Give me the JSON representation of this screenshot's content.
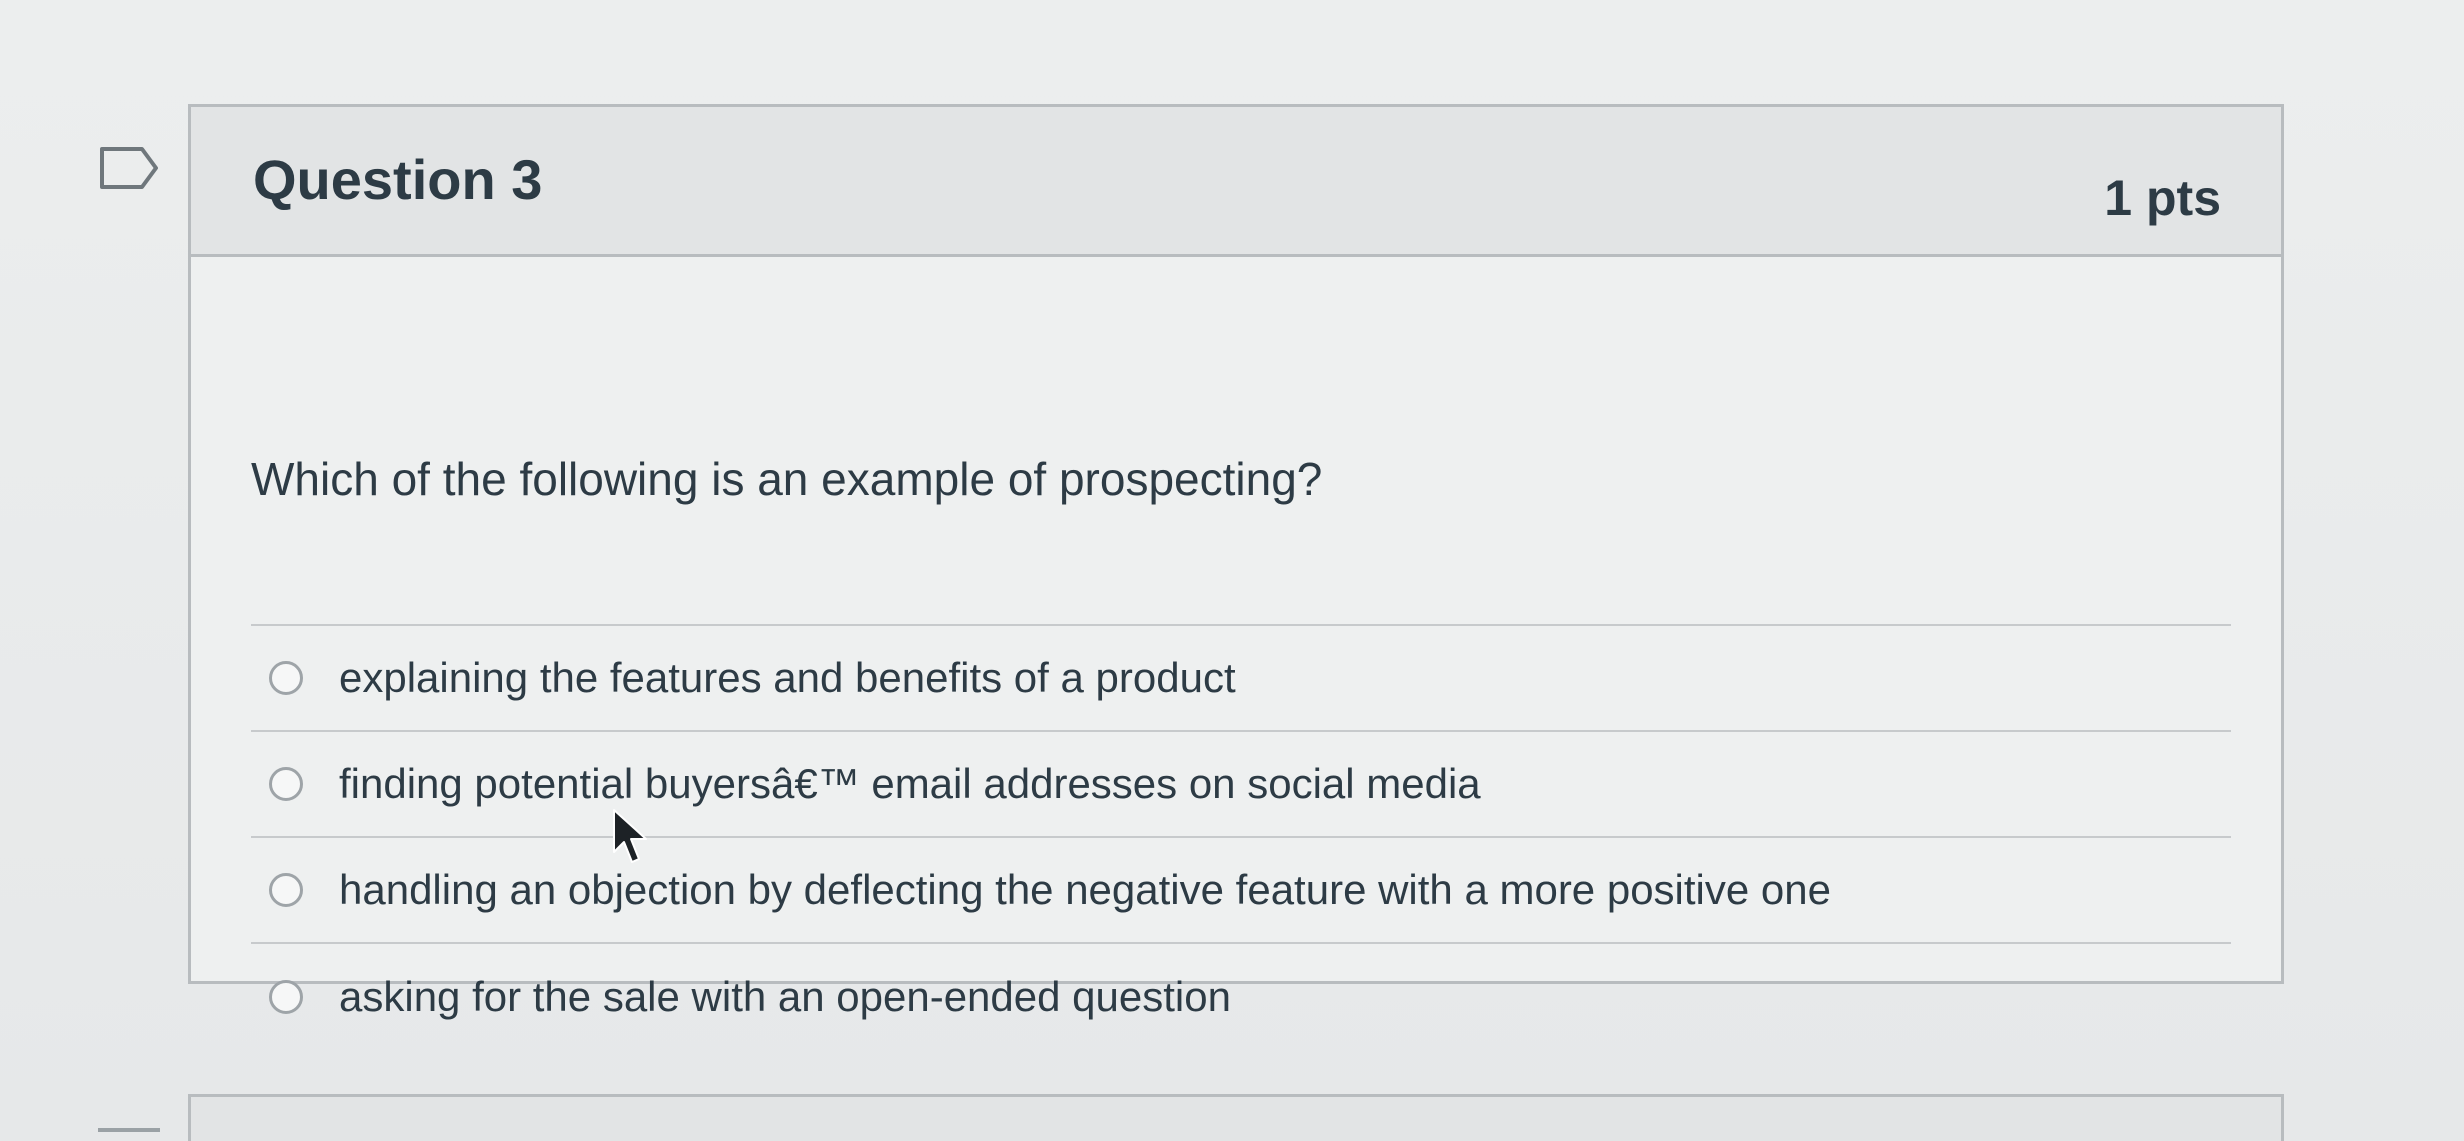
{
  "question": {
    "title": "Question 3",
    "points": "1 pts",
    "text": "Which of the following is an example of prospecting?",
    "flag_icon": "flag-icon",
    "answers": [
      {
        "label": "explaining the features and benefits of a product"
      },
      {
        "label": "finding potential buyersâ€™ email addresses on social media"
      },
      {
        "label": "handling an objection by deflecting the negative feature with a more positive one"
      },
      {
        "label": "asking for the sale with an open-ended question"
      }
    ]
  },
  "cursor_icon": "mouse-pointer-icon",
  "colors": {
    "text": "#2d3b45",
    "border": "#b8bcbf",
    "header_bg": "#e2e4e5",
    "radio_border": "#9ea4a8"
  }
}
